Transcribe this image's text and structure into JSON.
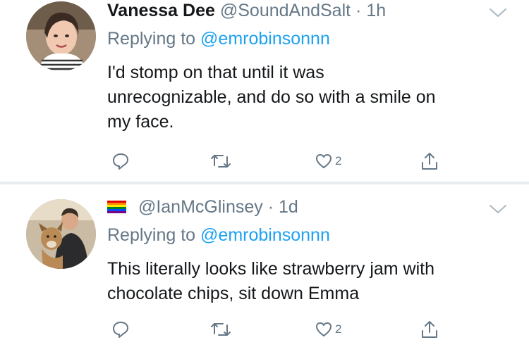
{
  "tweets": [
    {
      "display_name": "Vanessa Dee",
      "handle": "@SoundAndSalt",
      "separator": "·",
      "time": "1h",
      "replying_prefix": "Replying to",
      "replying_to": "@emrobinsonnn",
      "text_lines": [
        "I'd stomp on that until it was",
        "unrecognizable, and do so with a smile on",
        "my face."
      ],
      "reply_count": "",
      "retweet_count": "",
      "like_count": "2",
      "icons": {
        "avatar": "avatar-photo",
        "menu": "chevron-down-icon",
        "reply": "reply-icon",
        "retweet": "retweet-icon",
        "like": "heart-icon",
        "share": "share-icon"
      }
    },
    {
      "display_name": "",
      "handle": "@IanMcGlinsey",
      "separator": "·",
      "time": "1d",
      "name_icon": "rainbow-flag-icon",
      "replying_prefix": "Replying to",
      "replying_to": "@emrobinsonnn",
      "text_lines": [
        "This literally looks like strawberry jam with",
        "chocolate chips, sit down Emma"
      ],
      "reply_count": "",
      "retweet_count": "",
      "like_count": "2",
      "icons": {
        "avatar": "avatar-photo",
        "menu": "chevron-down-icon",
        "reply": "reply-icon",
        "retweet": "retweet-icon",
        "like": "heart-icon",
        "share": "share-icon"
      }
    }
  ],
  "colors": {
    "text": "#14171a",
    "secondary": "#657786",
    "link": "#1da1f2",
    "divider": "#e6ecf0",
    "background": "#ffffff"
  }
}
